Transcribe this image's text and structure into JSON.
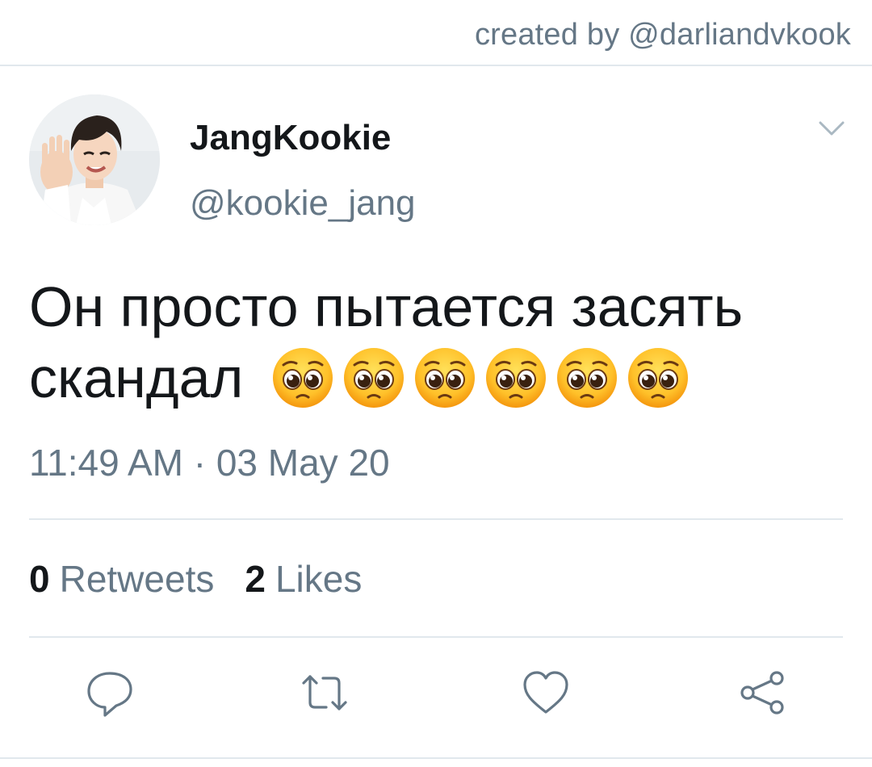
{
  "credit": "created by @darliandvkook",
  "user": {
    "display_name": "JangKookie",
    "handle": "@kookie_jang",
    "avatar_icon": "profile-photo"
  },
  "tweet": {
    "text_line1": "Он просто пытается засять",
    "text_line2": "скандал",
    "emoji": [
      "pleading-face",
      "pleading-face",
      "pleading-face",
      "pleading-face",
      "pleading-face",
      "pleading-face"
    ],
    "timestamp": "11:49 AM · 03 May 20"
  },
  "stats": {
    "retweets_count": "0",
    "retweets_label": "Retweets",
    "likes_count": "2",
    "likes_label": "Likes"
  },
  "actions": [
    "reply-icon",
    "retweet-icon",
    "like-icon",
    "share-icon"
  ],
  "colors": {
    "text": "#14171a",
    "secondary": "#657786",
    "divider": "#e1e8ed"
  }
}
